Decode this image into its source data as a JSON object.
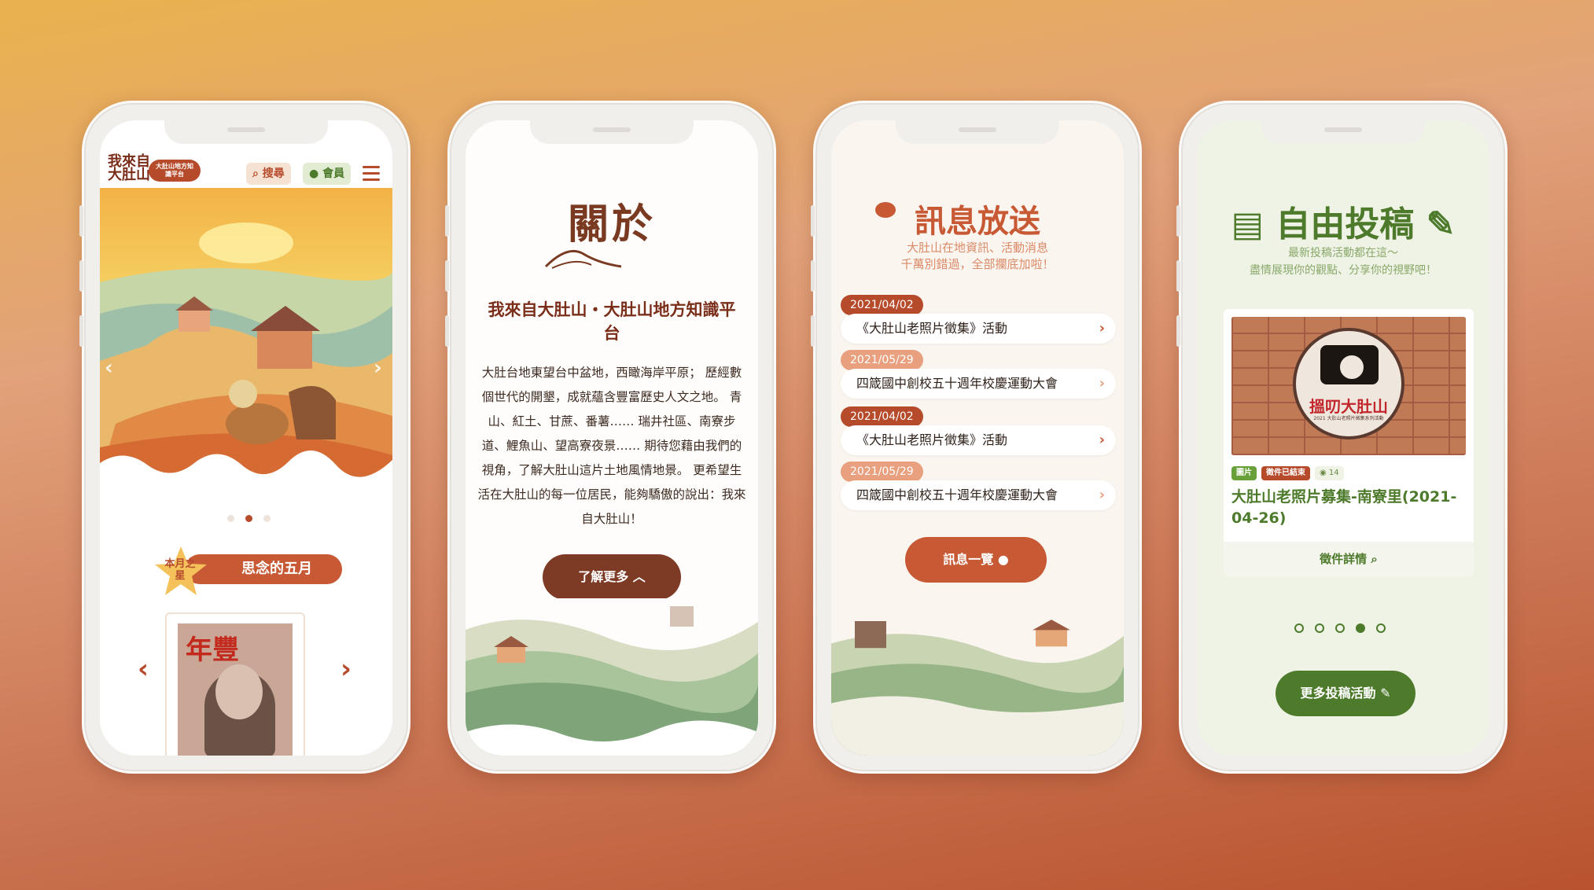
{
  "phone1": {
    "logo_text": "我來自大肚山",
    "logo_badge": "大肚山地方知識平台",
    "search_label": "搜尋",
    "member_label": "會員",
    "monthly_star_badge": "本月之星",
    "monthly_star_title": "思念的五月",
    "magazine_title": "年豐",
    "carousel_dots": 3,
    "carousel_active": 2
  },
  "phone2": {
    "title": "關於",
    "heading": "我來自大肚山・大肚山地方知識平台",
    "body": "大肚台地東望台中盆地，西瞰海岸平原； 歷經數個世代的開墾，成就蘊含豐富歷史人文之地。 青山、紅土、甘蔗、番薯…… 瑞井社區、南寮步道、鯉魚山、望高寮夜景…… 期待您藉由我們的視角，了解大肚山這片土地風情地景。 更希望生活在大肚山的每一位居民，能夠驕傲的說出：我來自大肚山！",
    "button_label": "了解更多 ︿"
  },
  "phone3": {
    "title": "訊息放送",
    "subtitle_line1": "大肚山在地資訊、活動消息",
    "subtitle_line2": "千萬別錯過，全部攔底加啦！",
    "items": [
      {
        "date": "2021/04/02",
        "title": "《大肚山老照片徵集》活動",
        "date_color": "#b64b2c"
      },
      {
        "date": "2021/05/29",
        "title": "四箴國中創校五十週年校慶運動大會",
        "date_color": "#e8a07f"
      },
      {
        "date": "2021/04/02",
        "title": "《大肚山老照片徵集》活動",
        "date_color": "#b64b2c"
      },
      {
        "date": "2021/05/29",
        "title": "四箴國中創校五十週年校慶運動大會",
        "date_color": "#e8a07f"
      }
    ],
    "button_label": "訊息一覽"
  },
  "phone4": {
    "title": "自由投稿",
    "subtitle_line1": "最新投稿活動都在這～",
    "subtitle_line2": "盡情展現你的觀點、分享你的視野吧！",
    "card": {
      "badge_text": "搵叨大肚山",
      "badge_small": "2021 大肚山老照片徵集系列活動",
      "tag_type": "圖片",
      "tag_status": "徵件已結束",
      "views": "14",
      "title": "大肚山老照片募集-南寮里(2021-04-26)",
      "footer": "徵件詳情"
    },
    "carousel_dots": 5,
    "carousel_active": 4,
    "button_label": "更多投稿活動"
  },
  "colors": {
    "brown": "#7d3a25",
    "rust": "#c75a35",
    "green": "#4d7a2b"
  }
}
